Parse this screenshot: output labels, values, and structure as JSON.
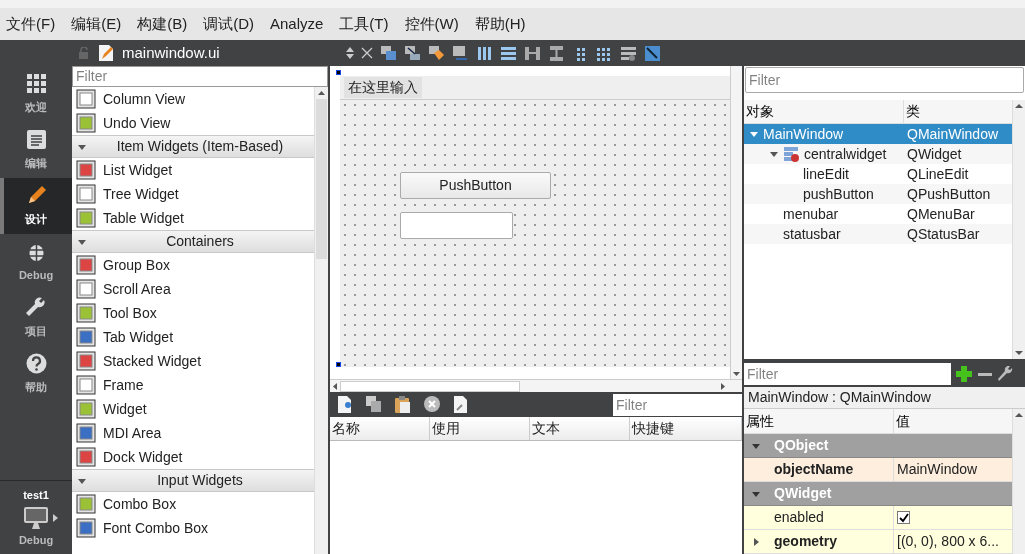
{
  "menubar": [
    "文件(F)",
    "编辑(E)",
    "构建(B)",
    "调试(D)",
    "Analyze",
    "工具(T)",
    "控件(W)",
    "帮助(H)"
  ],
  "editor": {
    "file_name": "mainwindow.ui"
  },
  "modes": [
    {
      "label": "欢迎",
      "selected": false
    },
    {
      "label": "编辑",
      "selected": false
    },
    {
      "label": "设计",
      "selected": true
    },
    {
      "label": "Debug",
      "selected": false
    },
    {
      "label": "项目",
      "selected": false
    },
    {
      "label": "帮助",
      "selected": false
    }
  ],
  "kit": {
    "project": "test1",
    "build": "Debug"
  },
  "widget_box": {
    "filter_placeholder": "Filter",
    "items": [
      {
        "kind": "item",
        "label": "Column View"
      },
      {
        "kind": "item",
        "label": "Undo View"
      },
      {
        "kind": "category",
        "label": "Item Widgets (Item-Based)",
        "expanded": true
      },
      {
        "kind": "item",
        "label": "List Widget"
      },
      {
        "kind": "item",
        "label": "Tree Widget"
      },
      {
        "kind": "item",
        "label": "Table Widget"
      },
      {
        "kind": "category",
        "label": "Containers",
        "expanded": true
      },
      {
        "kind": "item",
        "label": "Group Box"
      },
      {
        "kind": "item",
        "label": "Scroll Area"
      },
      {
        "kind": "item",
        "label": "Tool Box"
      },
      {
        "kind": "item",
        "label": "Tab Widget"
      },
      {
        "kind": "item",
        "label": "Stacked Widget"
      },
      {
        "kind": "item",
        "label": "Frame"
      },
      {
        "kind": "item",
        "label": "Widget"
      },
      {
        "kind": "item",
        "label": "MDI Area"
      },
      {
        "kind": "item",
        "label": "Dock Widget"
      },
      {
        "kind": "category",
        "label": "Input Widgets",
        "expanded": true
      },
      {
        "kind": "item",
        "label": "Combo Box"
      },
      {
        "kind": "item",
        "label": "Font Combo Box"
      }
    ]
  },
  "form": {
    "menu_placeholder": "在这里输入",
    "push_button": "PushButton"
  },
  "action_editor": {
    "filter_placeholder": "Filter",
    "columns": [
      "名称",
      "使用",
      "文本",
      "快捷键"
    ]
  },
  "object_inspector": {
    "filter_placeholder": "Filter",
    "columns": [
      "对象",
      "类"
    ],
    "tree": [
      {
        "object": "MainWindow",
        "class": "QMainWindow",
        "selected": true,
        "expanded": true,
        "children": [
          {
            "object": "centralwidget",
            "class": "QWidget",
            "selected": false,
            "expanded": true,
            "children": [
              {
                "object": "lineEdit",
                "class": "QLineEdit",
                "selected": false
              },
              {
                "object": "pushButton",
                "class": "QPushButton",
                "selected": false
              }
            ]
          },
          {
            "object": "menubar",
            "class": "QMenuBar",
            "selected": false
          },
          {
            "object": "statusbar",
            "class": "QStatusBar",
            "selected": false
          }
        ]
      }
    ]
  },
  "property_editor": {
    "filter_placeholder": "Filter",
    "context": "MainWindow : QMainWindow",
    "columns": [
      "属性",
      "值"
    ],
    "rows": [
      {
        "kind": "group",
        "label": "QObject",
        "expanded": true
      },
      {
        "kind": "property",
        "name": "objectName",
        "value": "MainWindow",
        "modified": true
      },
      {
        "kind": "group",
        "label": "QWidget",
        "expanded": true
      },
      {
        "kind": "property",
        "name": "enabled",
        "checked": true,
        "modified": false
      },
      {
        "kind": "property",
        "name": "geometry",
        "value": "[(0, 0), 800 x 6...",
        "modified": true,
        "expanded": false
      }
    ]
  }
}
